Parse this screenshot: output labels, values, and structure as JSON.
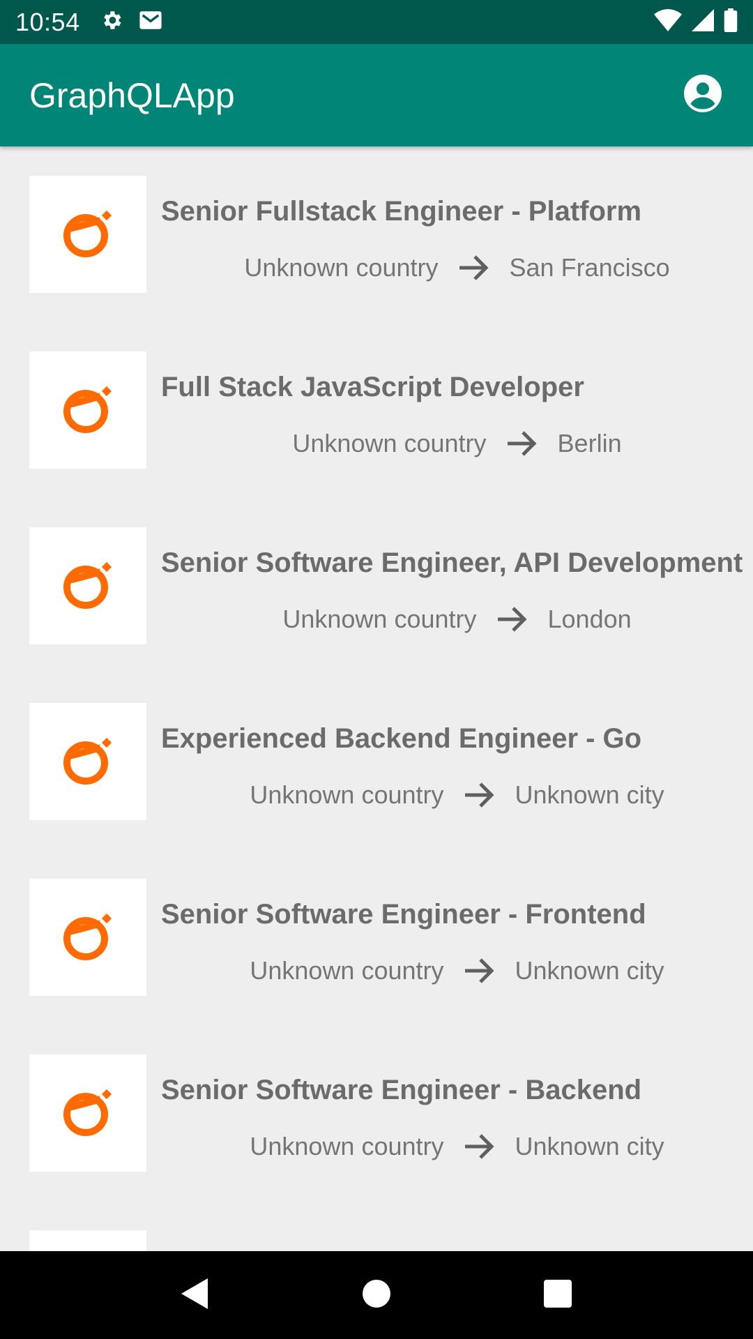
{
  "status_bar": {
    "time": "10:54",
    "left_icons": [
      "gear-icon",
      "mail-icon"
    ],
    "right_icons": [
      "wifi-icon",
      "signal-icon",
      "battery-icon"
    ]
  },
  "app_bar": {
    "title": "GraphQLApp",
    "action_icon": "account-circle-icon",
    "color": "#008577"
  },
  "colors": {
    "status_bar": "#00574b",
    "logo_accent": "#ff6b00",
    "background": "#eeeeee"
  },
  "jobs": [
    {
      "title": "Senior Fullstack Engineer - Platform",
      "country": "Unknown country",
      "city": "San Francisco"
    },
    {
      "title": "Full Stack JavaScript Developer",
      "country": "Unknown country",
      "city": "Berlin"
    },
    {
      "title": "Senior Software Engineer, API Development",
      "country": "Unknown country",
      "city": "London"
    },
    {
      "title": "Experienced Backend Engineer - Go",
      "country": "Unknown country",
      "city": "Unknown city"
    },
    {
      "title": "Senior Software Engineer - Frontend",
      "country": "Unknown country",
      "city": "Unknown city"
    },
    {
      "title": "Senior Software Engineer - Backend",
      "country": "Unknown country",
      "city": "Unknown city"
    },
    {
      "title": "",
      "country": "",
      "city": ""
    }
  ],
  "nav_bar": {
    "buttons": [
      "back-icon",
      "home-icon",
      "recents-icon"
    ]
  }
}
